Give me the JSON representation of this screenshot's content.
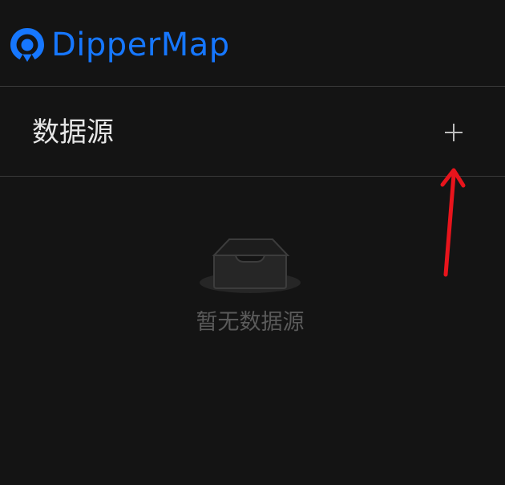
{
  "app": {
    "name": "DipperMap",
    "brand_color": "#1677ff",
    "logo_icon": "dippermap-logo-icon"
  },
  "section": {
    "title": "数据源",
    "add_icon": "plus-icon"
  },
  "empty_state": {
    "icon": "empty-inbox-icon",
    "message": "暂无数据源"
  },
  "annotation": {
    "arrow_color": "#e8141c",
    "arrow_icon": "red-arrow-annotation"
  }
}
